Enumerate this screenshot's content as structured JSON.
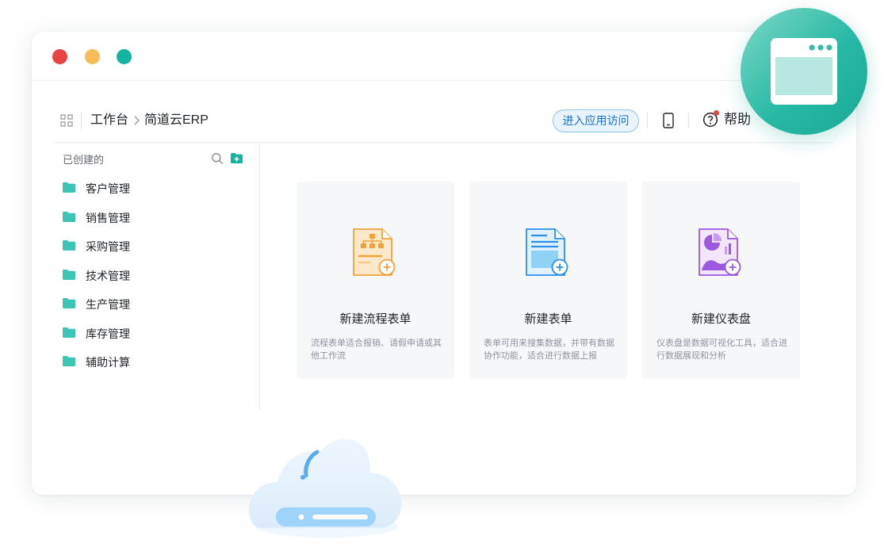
{
  "window": {
    "traffic_lights": {
      "close_color": "#e84444",
      "minimize_color": "#f6bd58",
      "zoom_color": "#14b5a0"
    }
  },
  "topbar": {
    "breadcrumb": {
      "root": "工作台",
      "current": "简道云ERP"
    },
    "access_button": "进入应用访问",
    "help_label": "帮助"
  },
  "sidebar": {
    "title": "已创建的",
    "items": [
      {
        "label": "客户管理",
        "icon": "folder-icon"
      },
      {
        "label": "销售管理",
        "icon": "folder-icon"
      },
      {
        "label": "采购管理",
        "icon": "folder-icon"
      },
      {
        "label": "技术管理",
        "icon": "folder-icon"
      },
      {
        "label": "生产管理",
        "icon": "folder-icon"
      },
      {
        "label": "库存管理",
        "icon": "folder-icon"
      },
      {
        "label": "辅助计算",
        "icon": "folder-icon"
      }
    ]
  },
  "cards": [
    {
      "title": "新建流程表单",
      "desc": "流程表单适合报销、请假申请或其他工作流",
      "icon": "workflow-form-icon",
      "color": "#f0a13b"
    },
    {
      "title": "新建表单",
      "desc": "表单可用来搜集数据，并带有数据协作功能，适合进行数据上报",
      "icon": "form-icon",
      "color": "#2b8ee8"
    },
    {
      "title": "新建仪表盘",
      "desc": "仪表盘是数据可视化工具，适合进行数据展现和分析",
      "icon": "dashboard-icon",
      "color": "#9b59e0"
    }
  ],
  "colors": {
    "accent": "#14b5a0",
    "folder": "#3cc4b4",
    "link": "#1b72c7"
  },
  "decor": {
    "badge_icon": "browser-window-icon",
    "cloud_icon": "cloud-server-icon"
  }
}
